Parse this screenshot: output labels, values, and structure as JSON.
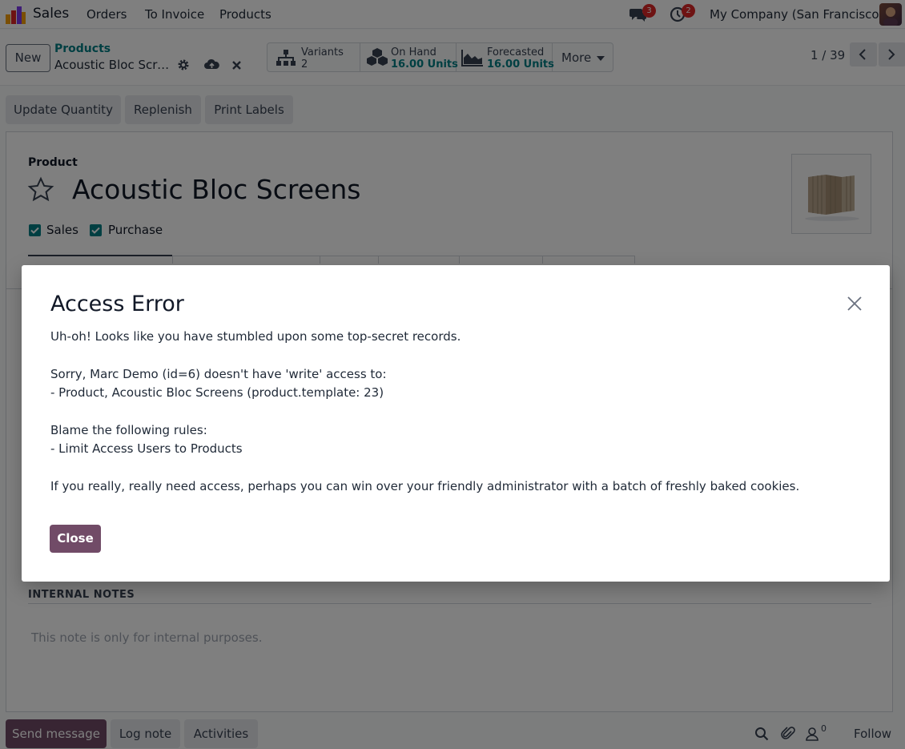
{
  "navbar": {
    "app_name": "Sales",
    "menu": [
      "Orders",
      "To Invoice",
      "Products"
    ],
    "messages_count": "3",
    "activities_count": "2",
    "company": "My Company (San Francisco)"
  },
  "control_panel": {
    "new_label": "New",
    "breadcrumb_parent": "Products",
    "breadcrumb_current": "Acoustic Bloc Screens",
    "smart_buttons": [
      {
        "label": "Variants",
        "value": "2"
      },
      {
        "label": "On Hand",
        "value": "16.00 Units"
      },
      {
        "label": "Forecasted",
        "value": "16.00 Units"
      }
    ],
    "more_label": "More",
    "pager": "1 / 39"
  },
  "actions": [
    "Update Quantity",
    "Replenish",
    "Print Labels"
  ],
  "form": {
    "product_label": "Product",
    "product_name": "Acoustic Bloc Screens",
    "sales_label": "Sales",
    "purchase_label": "Purchase",
    "notes_heading": "INTERNAL NOTES",
    "notes_placeholder": "This note is only for internal purposes."
  },
  "chatter": {
    "send_message": "Send message",
    "log_note": "Log note",
    "activities": "Activities",
    "followers_count": "0",
    "follow": "Follow"
  },
  "dialog": {
    "title": "Access Error",
    "lines": [
      "Uh-oh! Looks like you have stumbled upon some top-secret records.",
      "Sorry, Marc Demo (id=6) doesn't have 'write' access to:",
      "- Product, Acoustic Bloc Screens (product.template: 23)",
      "Blame the following rules:",
      "- Limit Access Users to Products",
      "If you really, really need access, perhaps you can win over your friendly administrator with a batch of freshly baked cookies."
    ],
    "close_label": "Close"
  },
  "colors": {
    "primary": "#714b67",
    "accent": "#017e84",
    "badge": "#dc2626"
  }
}
